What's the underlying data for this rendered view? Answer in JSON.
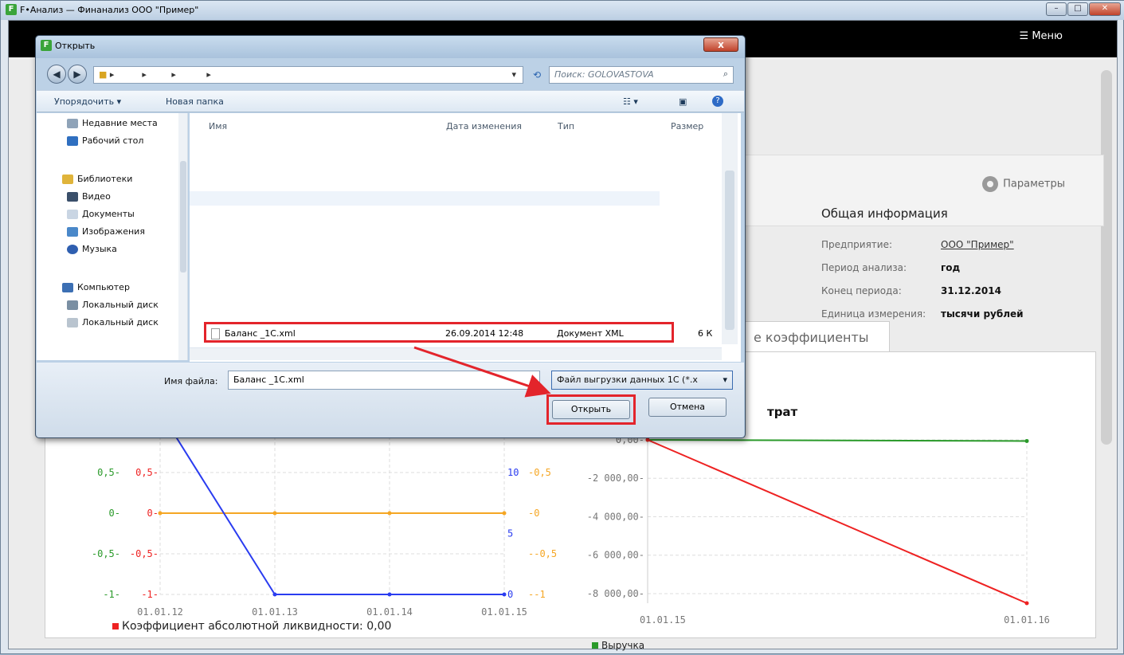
{
  "window": {
    "title": "F•Анализ — Финанализ ООО \"Пример\"",
    "min_label": "–",
    "max_label": "□",
    "close_label": "✕"
  },
  "app": {
    "menu_label": "Меню",
    "params_label": "Параметры",
    "info": {
      "heading": "Общая информация",
      "rows": [
        {
          "key": "Предприятие:",
          "value": "ООО \"Пример\""
        },
        {
          "key": "Период анализа:",
          "value": "год"
        },
        {
          "key": "Конец периода:",
          "value": "31.12.2014"
        },
        {
          "key": "Единица измерения:",
          "value": "тысячи рублей"
        }
      ]
    },
    "tab_label": "е коэффициенты",
    "right_chart_title_fragment": "трат",
    "legend_left": "Коэффициент абсолютной ликвидности: 0,00",
    "legend_right": "Выручка"
  },
  "dialog": {
    "title": "Открыть",
    "close_label": "x",
    "search_placeholder": "Поиск: GOLOVASTOVA",
    "toolbar": {
      "organize": "Упорядочить ▾",
      "new_folder": "Новая папка"
    },
    "nav": [
      {
        "label": "Недавние места",
        "icon": "recent-places-icon"
      },
      {
        "label": "Рабочий стол",
        "icon": "desktop-icon"
      },
      {
        "label": "Библиотеки",
        "icon": "libraries-icon"
      },
      {
        "label": "Видео",
        "icon": "video-icon"
      },
      {
        "label": "Документы",
        "icon": "documents-icon"
      },
      {
        "label": "Изображения",
        "icon": "pictures-icon"
      },
      {
        "label": "Музыка",
        "icon": "music-icon"
      },
      {
        "label": "Компьютер",
        "icon": "computer-icon"
      },
      {
        "label": "Локальный диск",
        "icon": "drive-icon"
      },
      {
        "label": "Локальный диск",
        "icon": "drive-icon"
      }
    ],
    "columns": [
      "Имя",
      "Дата изменения",
      "Тип",
      "Размер"
    ],
    "file": {
      "name": "Баланс _1С.xml",
      "date": "26.09.2014 12:48",
      "type": "Документ XML",
      "size": "6 К"
    },
    "filename_label": "Имя файла:",
    "filename_value": "Баланс _1С.xml",
    "filetype_value": "Файл выгрузки данных 1С (*.x",
    "open_label": "Открыть",
    "cancel_label": "Отмена"
  },
  "chart_data": [
    {
      "type": "line",
      "x": [
        "01.01.12",
        "01.01.13",
        "01.01.14",
        "01.01.15"
      ],
      "y_left_ticks": [
        "0,5",
        "0",
        "-0,5",
        "-1"
      ],
      "y_left2_ticks": [
        "0,5",
        "0",
        "-0,5",
        "-1"
      ],
      "y_right_ticks": [
        "10",
        "5",
        "0"
      ],
      "y_right2_ticks": [
        "0,5",
        "0",
        "-0,5",
        "-1"
      ],
      "series": [
        {
          "color": "#f5a623",
          "values": [
            0,
            0,
            0,
            0
          ]
        },
        {
          "color": "#2a3cf0",
          "values": [
            15,
            0,
            0,
            0
          ]
        }
      ],
      "legend": [
        {
          "name": "Коэффициент абсолютной ликвидности: 0,00",
          "color": "#e22222"
        }
      ]
    },
    {
      "type": "line",
      "x": [
        "01.01.15",
        "01.01.16"
      ],
      "y_ticks": [
        "0,00",
        "-2 000,00",
        "-4 000,00",
        "-6 000,00",
        "-8 000,00"
      ],
      "ylim": [
        -8500,
        0
      ],
      "series": [
        {
          "name": "Выручка",
          "color": "#2a9a2a",
          "values": [
            0,
            -60
          ]
        },
        {
          "color": "#ee2222",
          "values": [
            0,
            -8500
          ]
        }
      ]
    }
  ]
}
